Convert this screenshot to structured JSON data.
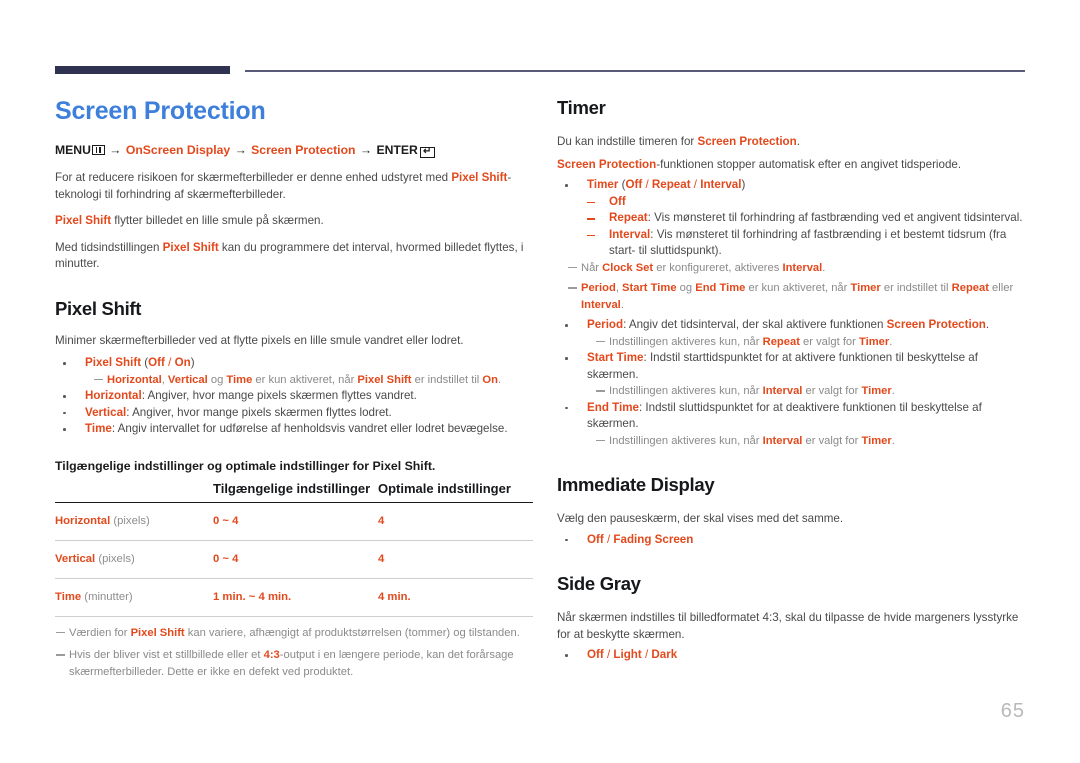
{
  "page": {
    "number": "65",
    "title": "Screen Protection",
    "title_color": "#3d7fdb",
    "accent_color": "#e2491c",
    "rule_color": "#2f3351"
  },
  "menu_path": {
    "menu_label": "MENU",
    "menu_icon": "menu-grid-icon",
    "arrow": "→",
    "item1": "OnScreen Display",
    "item2": "Screen Protection",
    "enter_label": "ENTER",
    "enter_icon": "enter-return-icon",
    "enter_glyph": "↵"
  },
  "intro": {
    "p1_pre": "For at reducere risikoen for skærmefterbilleder er denne enhed udstyret med ",
    "p1_hl": "Pixel Shift",
    "p1_post": "-teknologi til forhindring af skærmefterbilleder.",
    "p2_hl": "Pixel Shift",
    "p2_post": " flytter billedet en lille smule på skærmen.",
    "p3_pre": "Med tidsindstillingen ",
    "p3_hl": "Pixel Shift",
    "p3_post": " kan du programmere det interval, hvormed billedet flyttes, i minutter."
  },
  "pixel_shift": {
    "heading": "Pixel Shift",
    "intro": "Minimer skærmefterbilleder ved at flytte pixels en lille smule vandret eller lodret.",
    "bullets": [
      {
        "term": "Pixel Shift",
        "options_open": " (",
        "opt1": "Off",
        "sep": " / ",
        "opt2": "On",
        "options_close": ")"
      },
      {
        "term": "Horizontal",
        "rest": ": Angiver, hvor mange pixels skærmen flyttes vandret."
      },
      {
        "term": "Vertical",
        "rest": ": Angiver, hvor mange pixels skærmen flyttes lodret."
      },
      {
        "term": "Time",
        "rest": ": Angiv intervallet for udførelse af henholdsvis vandret eller lodret bevægelse."
      }
    ],
    "note_a": {
      "t1": "Horizontal",
      "s1": ", ",
      "t2": "Vertical",
      "s2": " og ",
      "t3": "Time",
      "s3": " er kun aktiveret, når ",
      "t4": "Pixel Shift",
      "s4": " er indstillet til ",
      "t5": "On",
      "s5": "."
    }
  },
  "table": {
    "caption": "Tilgængelige indstillinger og optimale indstillinger for Pixel Shift.",
    "headers": [
      "",
      "Tilgængelige indstillinger",
      "Optimale indstillinger"
    ],
    "rows": [
      {
        "label": "Horizontal",
        "unit": " (pixels)",
        "available": "0 ~ 4",
        "optimal": "4"
      },
      {
        "label": "Vertical",
        "unit": " (pixels)",
        "available": "0 ~ 4",
        "optimal": "4"
      },
      {
        "label": "Time",
        "unit": " (minutter)",
        "available": "1 min. ~ 4 min.",
        "optimal": "4 min."
      }
    ],
    "notes": [
      {
        "pre": "Værdien for ",
        "hl": "Pixel Shift",
        "post": " kan variere, afhængigt af produktstørrelsen (tommer) og tilstanden."
      },
      {
        "pre": "Hvis der bliver vist et stillbillede eller et ",
        "hl": "4:3",
        "post": "-output i en længere periode, kan det forårsage skærmefterbilleder. Dette er ikke en defekt ved produktet."
      }
    ]
  },
  "timer": {
    "heading": "Timer",
    "p1_pre": "Du kan indstille timeren for ",
    "p1_hl": "Screen Protection",
    "p1_post": ".",
    "p2_hl": "Screen Protection",
    "p2_post": "-funktionen stopper automatisk efter en angivet tidsperiode.",
    "bullet_timer": {
      "term": "Timer",
      "open": " (",
      "opt1": "Off",
      "sep1": " / ",
      "opt2": "Repeat",
      "sep2": " / ",
      "opt3": "Interval",
      "close": ")"
    },
    "subitems": [
      {
        "term": "Off",
        "rest": ""
      },
      {
        "term": "Repeat",
        "rest": ": Vis mønsteret til forhindring af fastbrænding ved et angivent tidsinterval."
      },
      {
        "term": "Interval",
        "rest": ": Vis mønsteret til forhindring af fastbrænding i et bestemt tidsrum (fra start- til sluttidspunkt)."
      }
    ],
    "note_clockset": {
      "pre": "Når ",
      "t1": "Clock Set",
      "mid": " er konfigureret, aktiveres ",
      "t2": "Interval",
      "post": "."
    },
    "note_period": {
      "t1": "Period",
      "s1": ", ",
      "t2": "Start Time",
      "s2": " og ",
      "t3": "End Time",
      "s3": " er kun aktiveret, når ",
      "t4": "Timer",
      "s4": " er indstillet til ",
      "t5": "Repeat",
      "s5": " eller ",
      "t6": "Interval",
      "s6": "."
    },
    "period": {
      "term": "Period",
      "mid": ": Angiv det tidsinterval, der skal aktivere funktionen ",
      "hl": "Screen Protection",
      "post": ".",
      "note_pre": "Indstillingen aktiveres kun, når ",
      "note_t1": "Repeat",
      "note_mid": " er valgt for ",
      "note_t2": "Timer",
      "note_post": "."
    },
    "start_time": {
      "term": "Start Time",
      "rest": ": Indstil starttidspunktet for at aktivere funktionen til beskyttelse af skærmen.",
      "note_pre": "Indstillingen aktiveres kun, når ",
      "note_t1": "Interval",
      "note_mid": " er valgt for ",
      "note_t2": "Timer",
      "note_post": "."
    },
    "end_time": {
      "term": "End Time",
      "rest": ": Indstil sluttidspunktet for at deaktivere funktionen til beskyttelse af skærmen.",
      "note_pre": "Indstillingen aktiveres kun, når ",
      "note_t1": "Interval",
      "note_mid": " er valgt for ",
      "note_t2": "Timer",
      "note_post": "."
    }
  },
  "immediate_display": {
    "heading": "Immediate Display",
    "intro": "Vælg den pauseskærm, der skal vises med det samme.",
    "opt1": "Off",
    "sep": " / ",
    "opt2": "Fading Screen"
  },
  "side_gray": {
    "heading": "Side Gray",
    "intro": "Når skærmen indstilles til billedformatet 4:3, skal du tilpasse de hvide margeners lysstyrke for at beskytte skærmen.",
    "opt1": "Off",
    "sep1": " / ",
    "opt2": "Light",
    "sep2": " / ",
    "opt3": "Dark"
  }
}
